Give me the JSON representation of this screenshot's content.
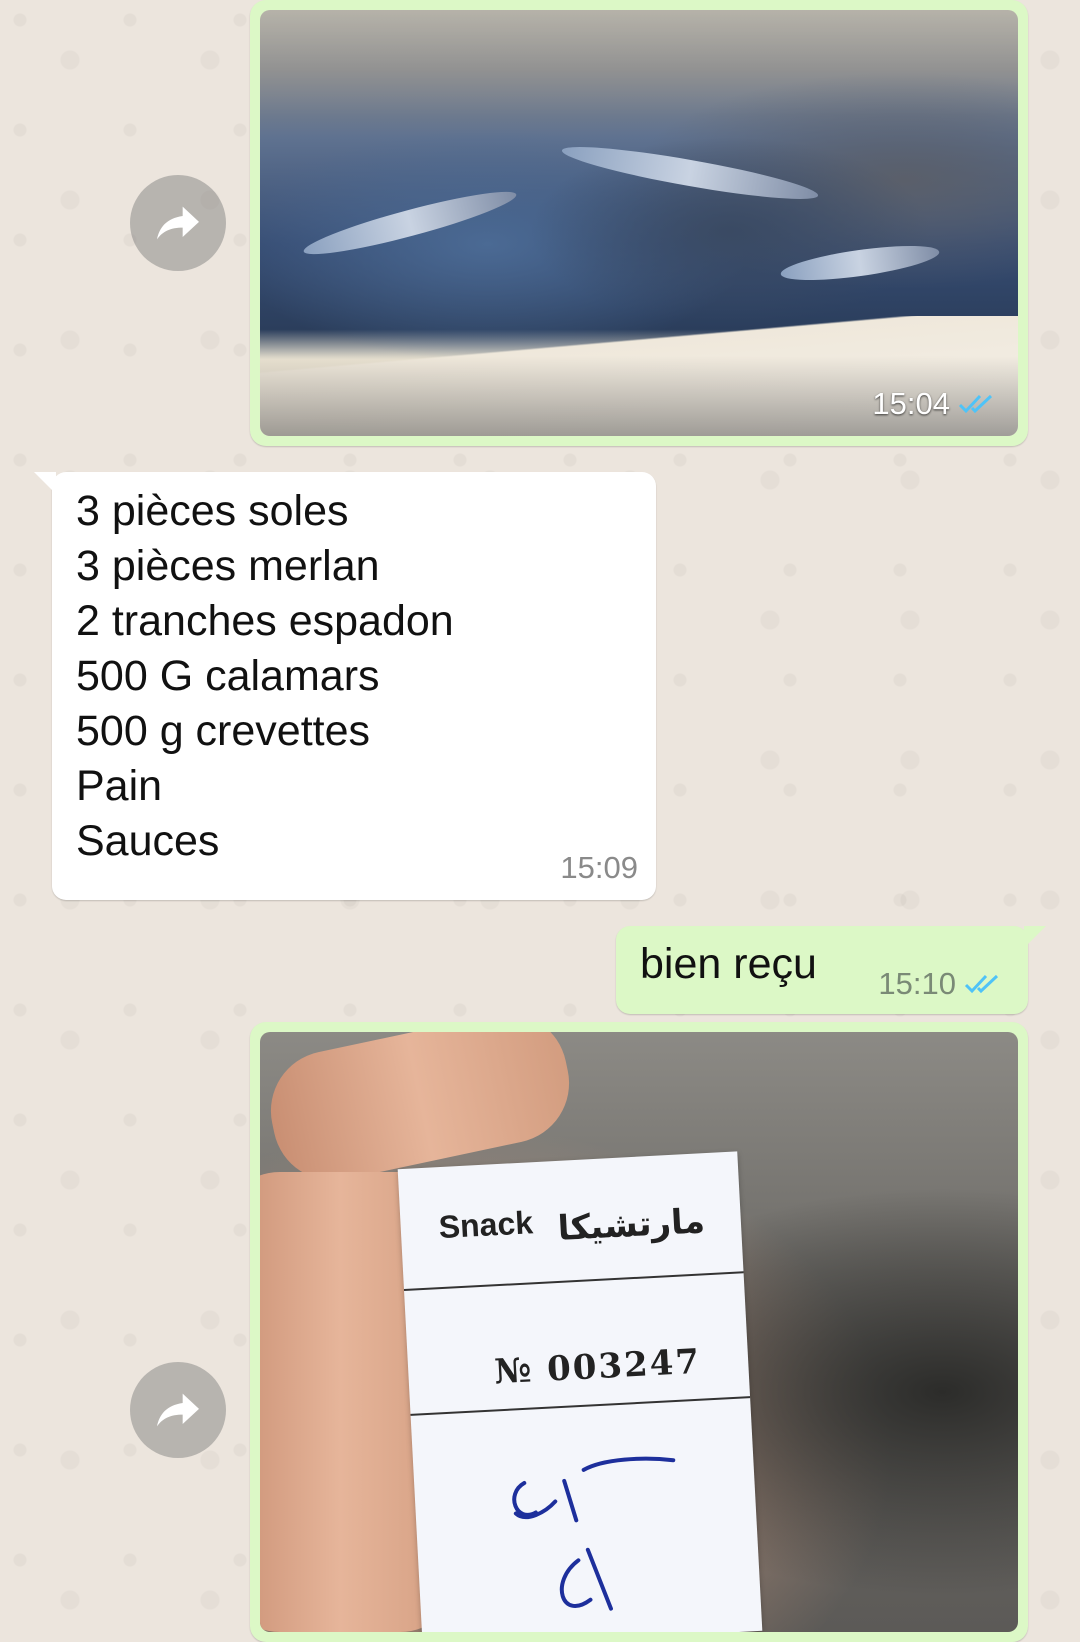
{
  "messages": [
    {
      "type": "image",
      "direction": "outgoing",
      "time": "15:04",
      "status": "read",
      "image": "seafood display case"
    },
    {
      "type": "text",
      "direction": "incoming",
      "time": "15:09",
      "lines": [
        "3 pièces soles",
        "3 pièces merlan",
        "2 tranches espadon",
        "500 G calamars",
        "500 g crevettes",
        "Pain",
        "Sauces"
      ]
    },
    {
      "type": "text",
      "direction": "outgoing",
      "time": "15:10",
      "status": "read",
      "text": "bien reçu"
    },
    {
      "type": "image",
      "direction": "outgoing",
      "image": "hand holding numbered ticket",
      "ticket": {
        "brand": "Snack",
        "brand_arabic": "مارتشيكا",
        "number": "№ 003247"
      }
    }
  ],
  "icons": {
    "forward": "forward-arrow-icon",
    "read_ticks": "double-check-icon"
  },
  "colors": {
    "outgoing_bubble": "#DCF8C6",
    "incoming_bubble": "#FFFFFF",
    "background": "#ECE5DD",
    "read_ticks": "#4FC3F7"
  }
}
